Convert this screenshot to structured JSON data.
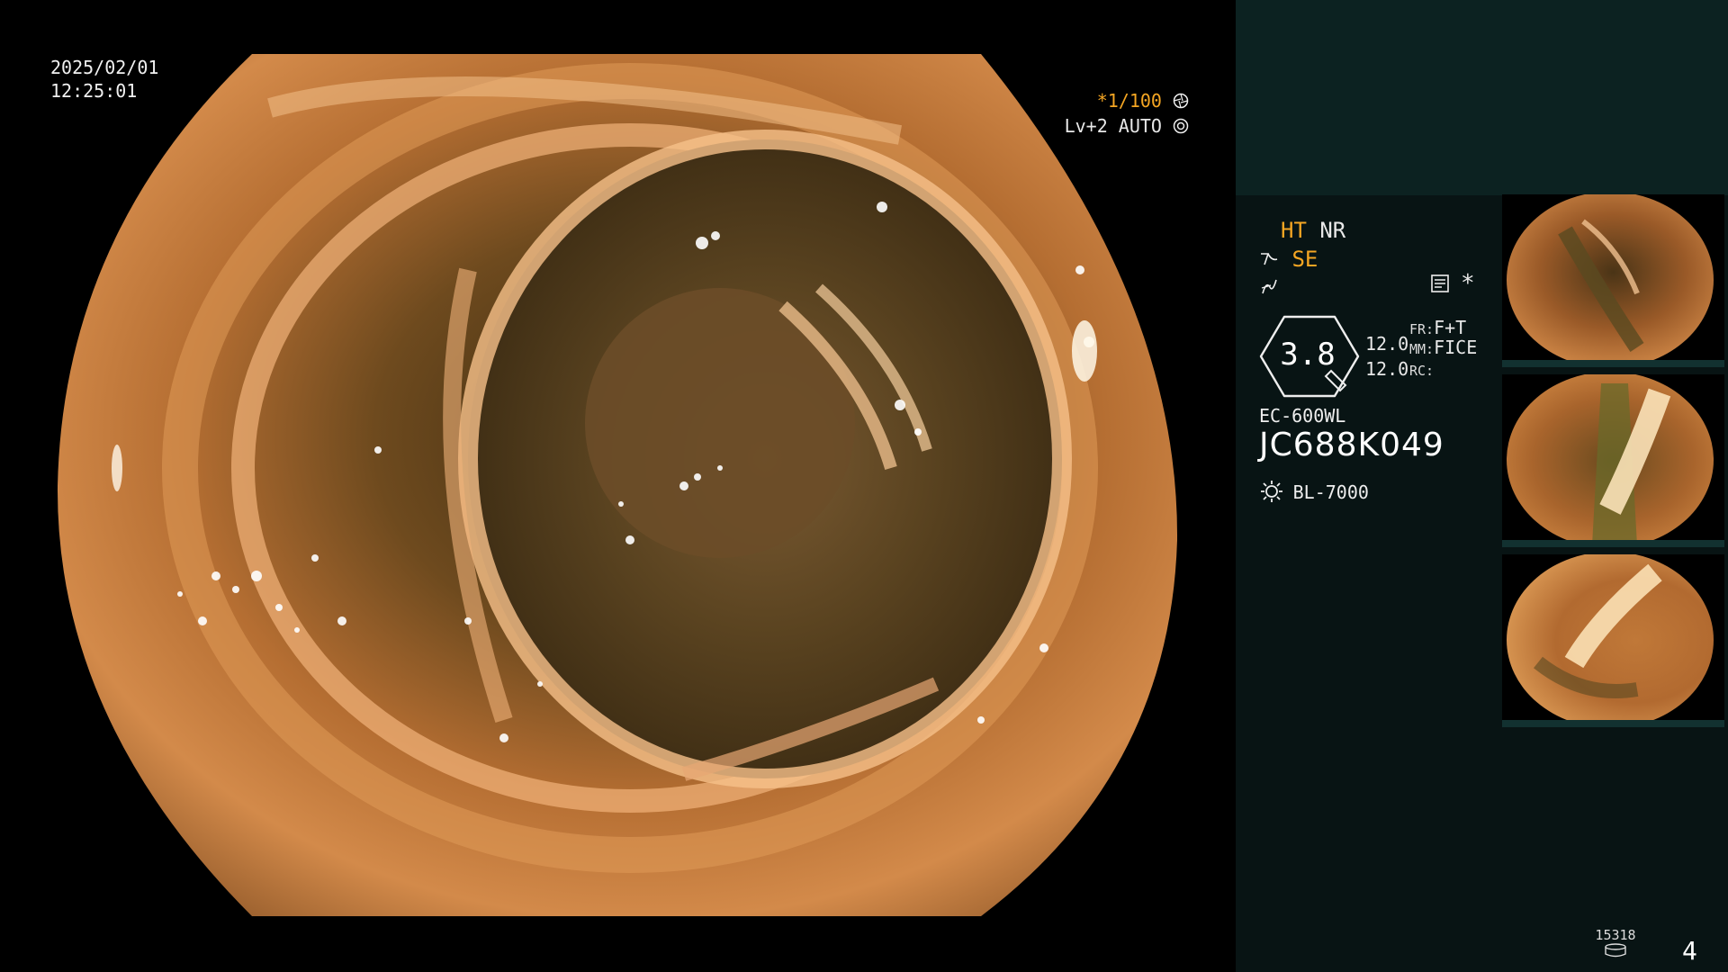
{
  "overlay": {
    "date": "2025/02/01",
    "time": "12:25:01",
    "shutter": "*1/100",
    "level": "Lv+2 AUTO"
  },
  "settings": {
    "ht": "HT",
    "nr": "NR",
    "se": "SE",
    "gauge_value": "3.8",
    "fr_label": "FR:",
    "fr_value": "F+T",
    "mm_label": "MM:",
    "mm_value": "FICE",
    "rc_label": "RC:",
    "val_top": "12.0",
    "val_bottom": "12.0",
    "asterisk": "*"
  },
  "device": {
    "model": "EC-600WL",
    "serial": "JC688K049",
    "light_source": "BL-7000"
  },
  "footer": {
    "image_count": "15318",
    "page": "4"
  },
  "icons": {
    "shutter_icon": "aperture-icon",
    "level_icon": "auto-iris-icon",
    "se_icon": "structure-enhance-icon",
    "curve_icon": "gamma-curve-icon",
    "memo_icon": "memo-icon",
    "gauge_icon": "zoom-gauge-icon",
    "light_icon": "light-source-icon",
    "storage_icon": "storage-icon"
  },
  "colors": {
    "accent_orange": "#f5a623",
    "panel_bg": "#081414",
    "panel_top_bg": "#0c2221"
  }
}
